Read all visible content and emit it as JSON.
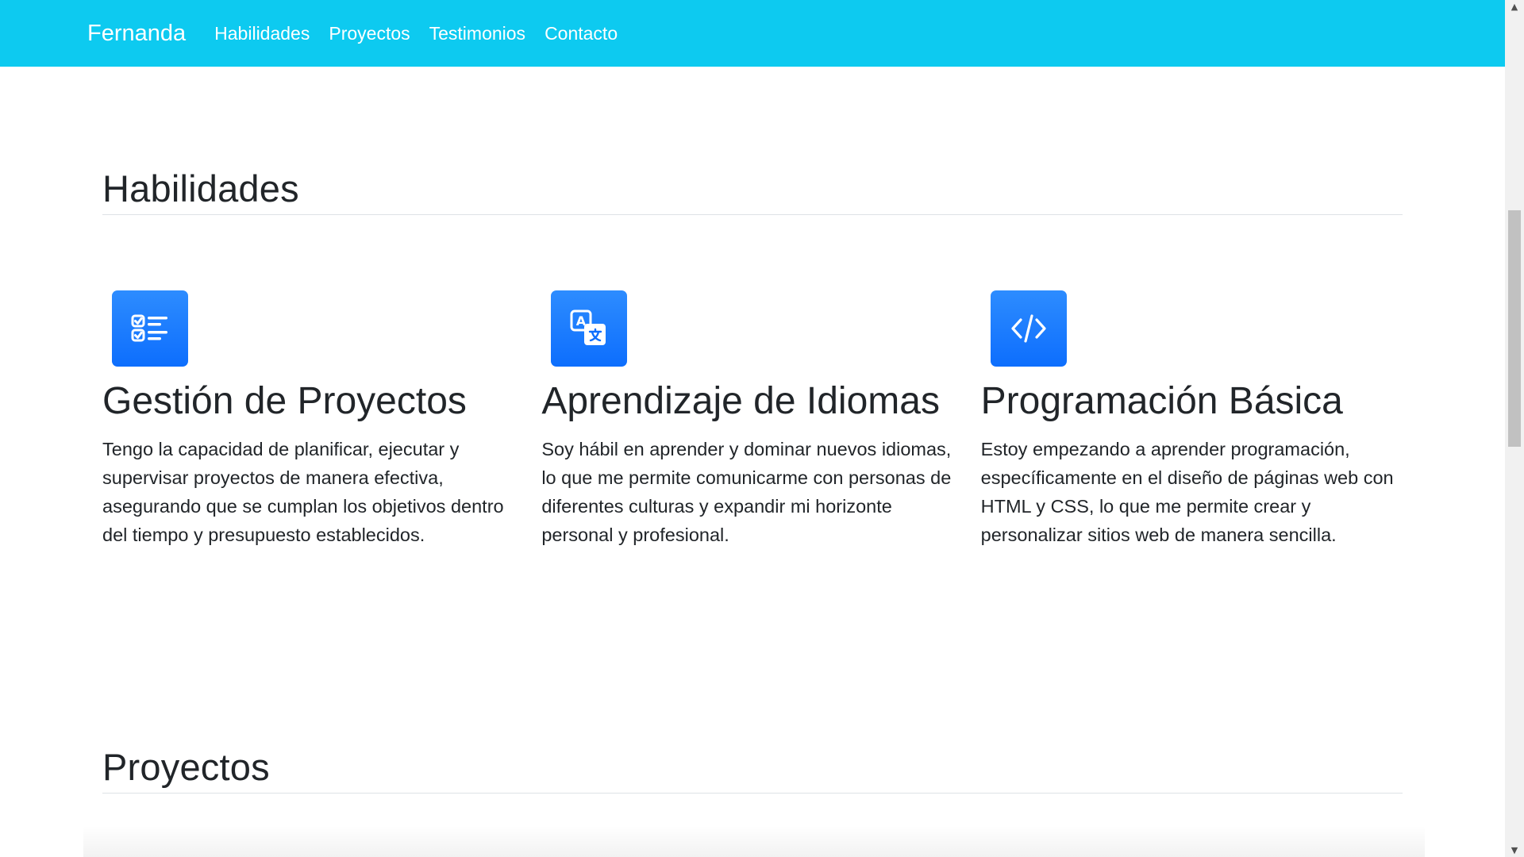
{
  "navbar": {
    "brand": "Fernanda",
    "links": [
      "Habilidades",
      "Proyectos",
      "Testimonios",
      "Contacto"
    ],
    "background": "#0dcaf0"
  },
  "skills": {
    "title": "Habilidades",
    "items": [
      {
        "icon": "checklist-icon",
        "title": "Gestión de Proyectos",
        "text": "Tengo la capacidad de planificar, ejecutar y supervisar proyectos de manera efectiva, asegurando que se cumplan los objetivos dentro del tiempo y presupuesto establecidos."
      },
      {
        "icon": "translate-icon",
        "title": "Aprendizaje de Idiomas",
        "text": "Soy hábil en aprender y dominar nuevos idiomas, lo que me permite comunicarme con personas de diferentes culturas y expandir mi horizonte personal y profesional."
      },
      {
        "icon": "code-icon",
        "title": "Programación Básica",
        "text": "Estoy empezando a aprender programación, específicamente en el diseño de páginas web con HTML y CSS, lo que me permite crear y personalizar sitios web de manera sencilla."
      }
    ],
    "icon_color": "#0d6efd"
  },
  "projects": {
    "title": "Proyectos"
  },
  "scrollbar": {
    "up_arrow": "▲",
    "down_arrow": "▼"
  }
}
